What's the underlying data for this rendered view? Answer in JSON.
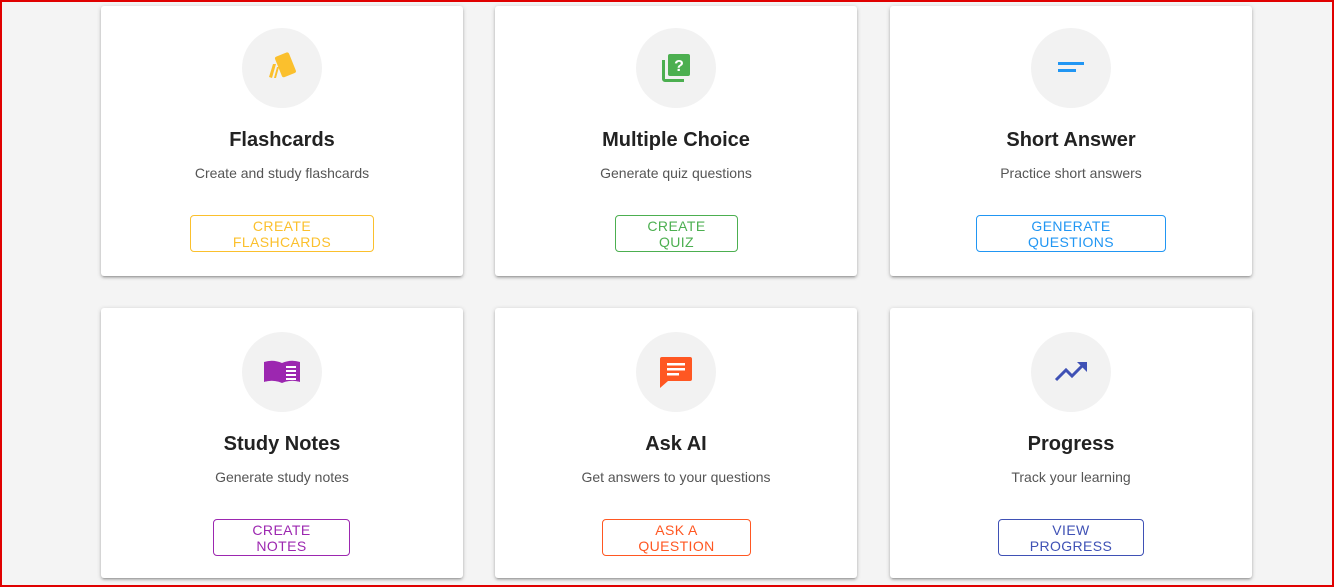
{
  "cards": [
    {
      "title": "Flashcards",
      "description": "Create and study flashcards",
      "button": "CREATE FLASHCARDS",
      "color": "#fbc02d",
      "icon": "flashcards-icon"
    },
    {
      "title": "Multiple Choice",
      "description": "Generate quiz questions",
      "button": "CREATE QUIZ",
      "color": "#4caf50",
      "icon": "quiz-icon"
    },
    {
      "title": "Short Answer",
      "description": "Practice short answers",
      "button": "GENERATE QUESTIONS",
      "color": "#2196f3",
      "icon": "short-text-icon"
    },
    {
      "title": "Study Notes",
      "description": "Generate study notes",
      "button": "CREATE NOTES",
      "color": "#9c27b0",
      "icon": "book-icon"
    },
    {
      "title": "Ask AI",
      "description": "Get answers to your questions",
      "button": "ASK A QUESTION",
      "color": "#ff5722",
      "icon": "chat-icon"
    },
    {
      "title": "Progress",
      "description": "Track your learning",
      "button": "VIEW PROGRESS",
      "color": "#3f51b5",
      "icon": "trending-up-icon"
    }
  ]
}
